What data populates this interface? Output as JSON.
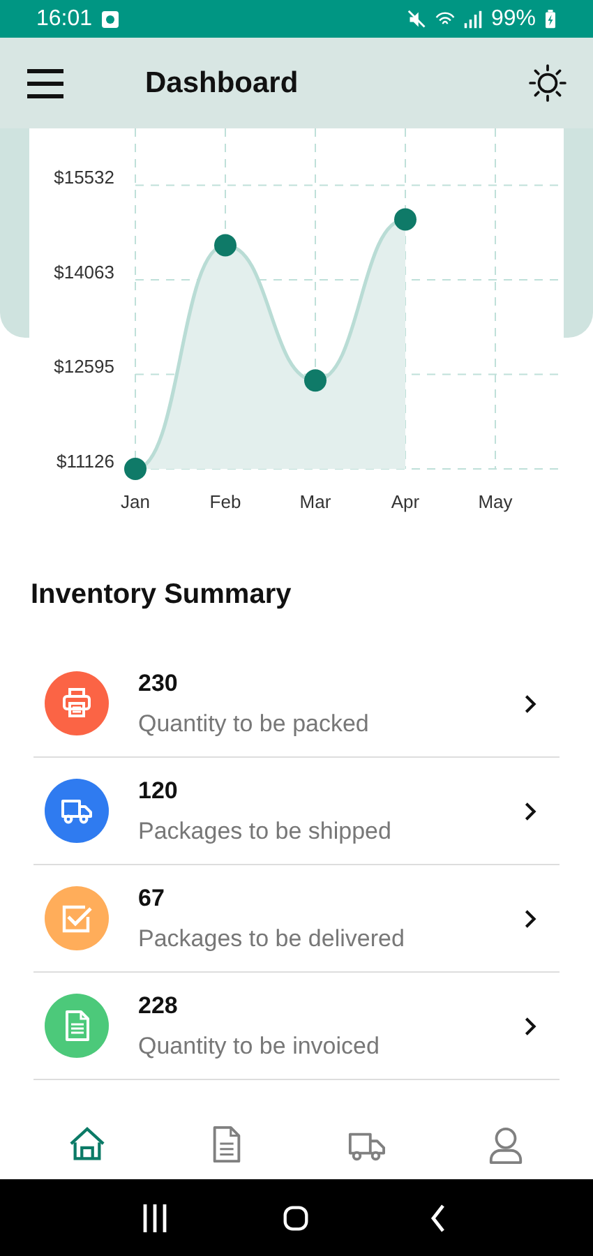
{
  "status_bar": {
    "time": "16:01",
    "battery": "99%"
  },
  "app_bar": {
    "title": "Dashboard"
  },
  "chart": {
    "chart_data": {
      "type": "area",
      "categories": [
        "Jan",
        "Feb",
        "Mar",
        "Apr",
        "May"
      ],
      "yticks": [
        {
          "value": 11126,
          "label": "$11126"
        },
        {
          "value": 12595,
          "label": "$12595"
        },
        {
          "value": 14063,
          "label": "$14063"
        },
        {
          "value": 15532,
          "label": "$15532"
        }
      ],
      "ylim": [
        11126,
        16415
      ],
      "grid": true,
      "series": [
        {
          "color": "#0f7a68",
          "values": [
            11126,
            14600,
            12500,
            15000,
            null
          ]
        }
      ]
    }
  },
  "inventory": {
    "title": "Inventory Summary",
    "items": [
      {
        "kind": "print",
        "count": "230",
        "label": "Quantity to be packed",
        "color": "#fb6445"
      },
      {
        "kind": "truck",
        "count": "120",
        "label": "Packages to be shipped",
        "color": "#2f7bf0"
      },
      {
        "kind": "check",
        "count": "67",
        "label": "Packages to be delivered",
        "color": "#ffad5a"
      },
      {
        "kind": "doc",
        "count": "228",
        "label": "Quantity to be invoiced",
        "color": "#4cc97a"
      }
    ]
  },
  "bottom_nav": [
    {
      "kind": "home",
      "selected": true
    },
    {
      "kind": "doc",
      "selected": false
    },
    {
      "kind": "truck",
      "selected": false
    },
    {
      "kind": "user",
      "selected": false
    }
  ]
}
